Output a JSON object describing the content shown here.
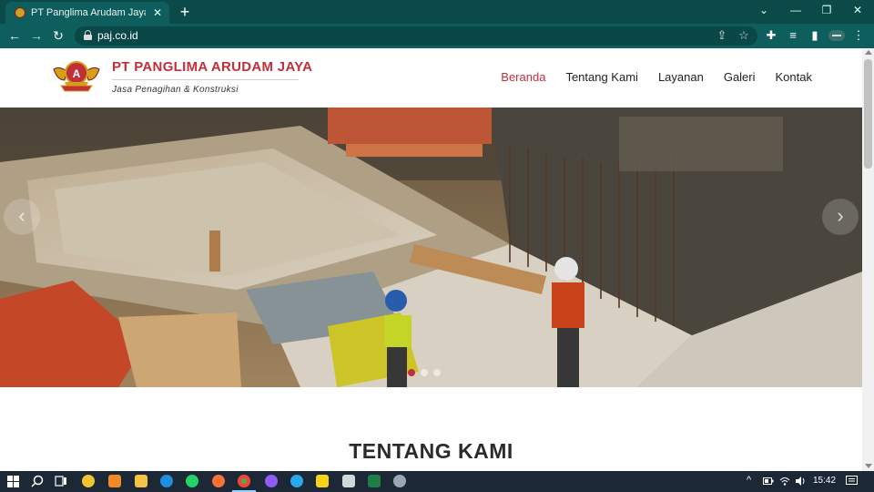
{
  "browser": {
    "tab_title": "PT Panglima Arudam Jaya - Jasa Penagihan & Konstruksi",
    "tab_close": "✕",
    "new_tab": "+",
    "url": "paj.co.id",
    "win_min": "—",
    "win_restore": "❐",
    "win_close": "✕",
    "tab_search": "⌄",
    "back": "←",
    "forward": "→",
    "reload": "↻",
    "share": "⇪",
    "bookmark": "☆",
    "extensions": "✚",
    "media": "≡",
    "side_panel": "▮",
    "menu": "⋮"
  },
  "site": {
    "brand_name": "PT PANGLIMA ARUDAM JAYA",
    "tagline": "Jasa Penagihan & Konstruksi",
    "nav": [
      "Beranda",
      "Tentang Kami",
      "Layanan",
      "Galeri",
      "Kontak"
    ],
    "active_nav": "Beranda",
    "carousel_prev": "‹",
    "carousel_next": "›",
    "section_title": "TENTANG KAMI",
    "accent_color": "#c0303a"
  },
  "taskbar": {
    "time": "15:42"
  }
}
